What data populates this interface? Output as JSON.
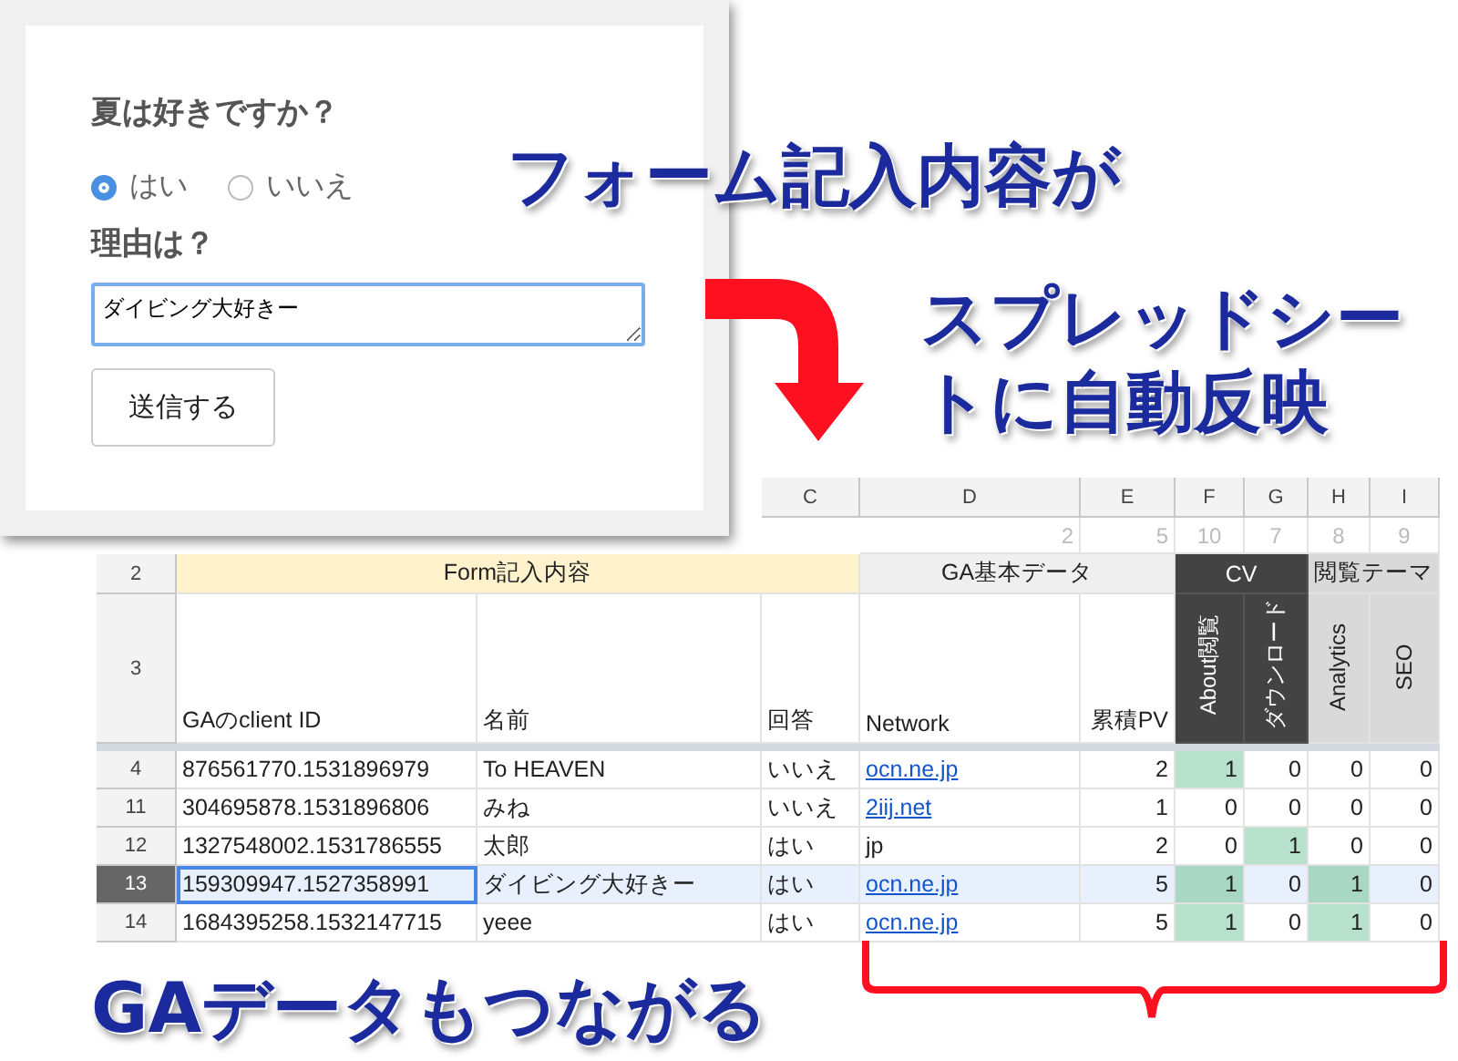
{
  "form": {
    "question": "夏は好きですか？",
    "options": [
      {
        "label": "はい",
        "selected": true
      },
      {
        "label": "いいえ",
        "selected": false
      }
    ],
    "reason_label": "理由は？",
    "reason_value": "ダイビング大好きー",
    "submit": "送信する"
  },
  "caption_top": "フォーム記入内容が",
  "caption_right": "スプレッドシートに自動反映",
  "caption_bottom": "GAデータもつながる",
  "sheet": {
    "column_letters": [
      "C",
      "D",
      "E",
      "F",
      "G",
      "H",
      "I"
    ],
    "row_1_values": [
      "2",
      "5",
      "10",
      "7",
      "8",
      "9"
    ],
    "group_row_number": "2",
    "label_row_number": "3",
    "groups": [
      {
        "title": "Form記入内容",
        "kind": "form",
        "columns": [
          "GAのclient ID",
          "名前",
          "回答"
        ]
      },
      {
        "title": "GA基本データ",
        "kind": "ga",
        "columns": [
          "Network",
          "累積PV"
        ]
      },
      {
        "title": "CV",
        "kind": "cv",
        "columns": [
          "About閲覧",
          "ダウンロード"
        ]
      },
      {
        "title": "閲覧テーマ",
        "kind": "theme",
        "columns": [
          "Analytics",
          "SEO"
        ]
      }
    ],
    "rows": [
      {
        "row_number": "4",
        "selected": false,
        "cells": [
          "876561770.1531896979",
          "To HEAVEN",
          "いいえ"
        ],
        "network": {
          "text": "ocn.ne.jp",
          "kind": "link"
        },
        "pv": "2",
        "metrics": [
          {
            "value": "1",
            "highlighted": true
          },
          {
            "value": "0",
            "highlighted": false
          },
          {
            "value": "0",
            "highlighted": false
          },
          {
            "value": "0",
            "highlighted": false
          }
        ]
      },
      {
        "row_number": "11",
        "selected": false,
        "cells": [
          "304695878.1531896806",
          "みね",
          "いいえ"
        ],
        "network": {
          "text": "2iij.net",
          "kind": "link"
        },
        "pv": "1",
        "metrics": [
          {
            "value": "0",
            "highlighted": false
          },
          {
            "value": "0",
            "highlighted": false
          },
          {
            "value": "0",
            "highlighted": false
          },
          {
            "value": "0",
            "highlighted": false
          }
        ]
      },
      {
        "row_number": "12",
        "selected": false,
        "cells": [
          "1327548002.1531786555",
          "太郎",
          "はい"
        ],
        "network": {
          "text": "jp",
          "kind": "text"
        },
        "pv": "2",
        "metrics": [
          {
            "value": "0",
            "highlighted": false
          },
          {
            "value": "1",
            "highlighted": true
          },
          {
            "value": "0",
            "highlighted": false
          },
          {
            "value": "0",
            "highlighted": false
          }
        ]
      },
      {
        "row_number": "13",
        "selected": true,
        "cells": [
          "159309947.1527358991",
          "ダイビング大好きー",
          "はい"
        ],
        "network": {
          "text": "ocn.ne.jp",
          "kind": "link"
        },
        "pv": "5",
        "metrics": [
          {
            "value": "1",
            "highlighted": true
          },
          {
            "value": "0",
            "highlighted": false
          },
          {
            "value": "1",
            "highlighted": true
          },
          {
            "value": "0",
            "highlighted": false
          }
        ]
      },
      {
        "row_number": "14",
        "selected": false,
        "cells": [
          "1684395258.1532147715",
          "yeee",
          "はい"
        ],
        "network": {
          "text": "ocn.ne.jp",
          "kind": "link"
        },
        "pv": "5",
        "metrics": [
          {
            "value": "1",
            "highlighted": true
          },
          {
            "value": "0",
            "highlighted": false
          },
          {
            "value": "1",
            "highlighted": true
          },
          {
            "value": "0",
            "highlighted": false
          }
        ]
      }
    ]
  }
}
